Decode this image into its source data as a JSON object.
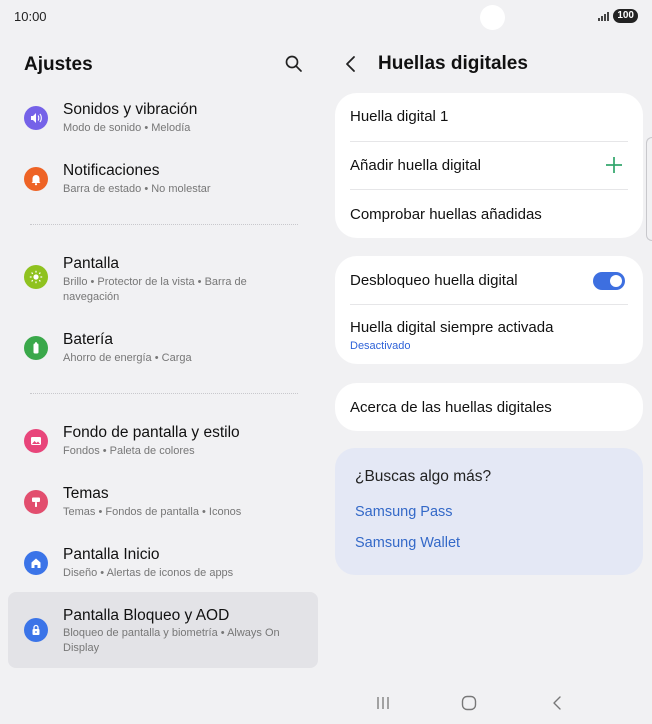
{
  "status_bar": {
    "time": "10:00",
    "battery": "100"
  },
  "left": {
    "header": "Ajustes",
    "items": [
      {
        "title": "Sonidos y vibración",
        "subtitle": "Modo de sonido  •  Melodía",
        "icon": "sound-icon",
        "color": "#7562e8"
      },
      {
        "title": "Notificaciones",
        "subtitle": "Barra de estado  •  No molestar",
        "icon": "bell-icon",
        "color": "#ee6325"
      },
      {
        "title": "Pantalla",
        "subtitle": "Brillo  •  Protector de la vista  •  Barra de navegación",
        "icon": "sun-icon",
        "color": "#8fc21f"
      },
      {
        "title": "Batería",
        "subtitle": "Ahorro de energía  •  Carga",
        "icon": "battery-icon",
        "color": "#3aa84a"
      },
      {
        "title": "Fondo de pantalla y estilo",
        "subtitle": "Fondos  •  Paleta de colores",
        "icon": "image-icon",
        "color": "#e8457a"
      },
      {
        "title": "Temas",
        "subtitle": "Temas  •  Fondos de pantalla  •  Iconos",
        "icon": "brush-icon",
        "color": "#e24e6e"
      },
      {
        "title": "Pantalla Inicio",
        "subtitle": "Diseño  •  Alertas de iconos de apps",
        "icon": "home-icon",
        "color": "#3b74e8"
      },
      {
        "title": "Pantalla Bloqueo y AOD",
        "subtitle": "Bloqueo de pantalla y biometría  •  Always On Display",
        "icon": "lock-icon",
        "color": "#3b74e8"
      }
    ]
  },
  "right": {
    "title": "Huellas digitales",
    "card1": {
      "row1": "Huella digital 1",
      "row2": "Añadir huella digital",
      "row3": "Comprobar huellas añadidas"
    },
    "card2": {
      "row1": "Desbloqueo huella digital",
      "row1_toggle": "on",
      "row2": "Huella digital siempre activada",
      "row2_sub": "Desactivado"
    },
    "card3": {
      "row1": "Acerca de las huellas digitales"
    },
    "suggest": {
      "title": "¿Buscas algo más?",
      "link1": "Samsung Pass",
      "link2": "Samsung Wallet"
    }
  },
  "colors": {
    "accent": "#3d6fe0",
    "plus": "#2fa56a",
    "link": "#3469c8"
  }
}
